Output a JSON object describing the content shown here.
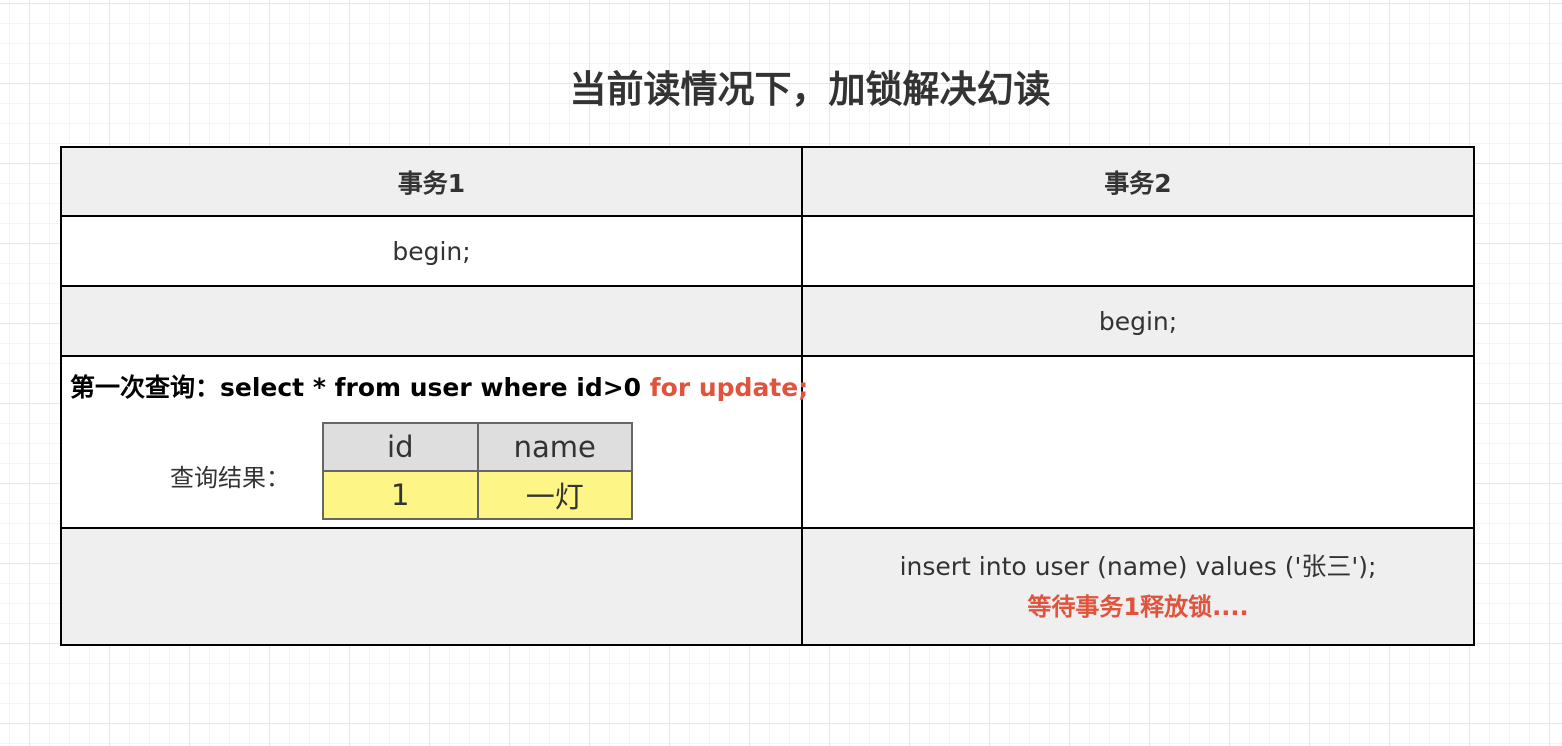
{
  "title": "当前读情况下，加锁解决幻读",
  "headers": {
    "tx1": "事务1",
    "tx2": "事务2"
  },
  "rows": [
    {
      "tx1": "begin;",
      "tx2": ""
    },
    {
      "tx1": "",
      "tx2": "begin;"
    }
  ],
  "query": {
    "prefix": "第一次查询：select * from user where id>0 ",
    "highlight": "for update;",
    "result_label": "查询结果：",
    "result_table": {
      "columns": [
        "id",
        "name"
      ],
      "rows": [
        [
          "1",
          "一灯"
        ]
      ]
    }
  },
  "insert": {
    "statement": "insert into user (name) values ('张三');",
    "status": "等待事务1释放锁...."
  },
  "colors": {
    "highlight": "#e0533c",
    "result_row": "#fdf585",
    "header_bg": "#efefef"
  }
}
